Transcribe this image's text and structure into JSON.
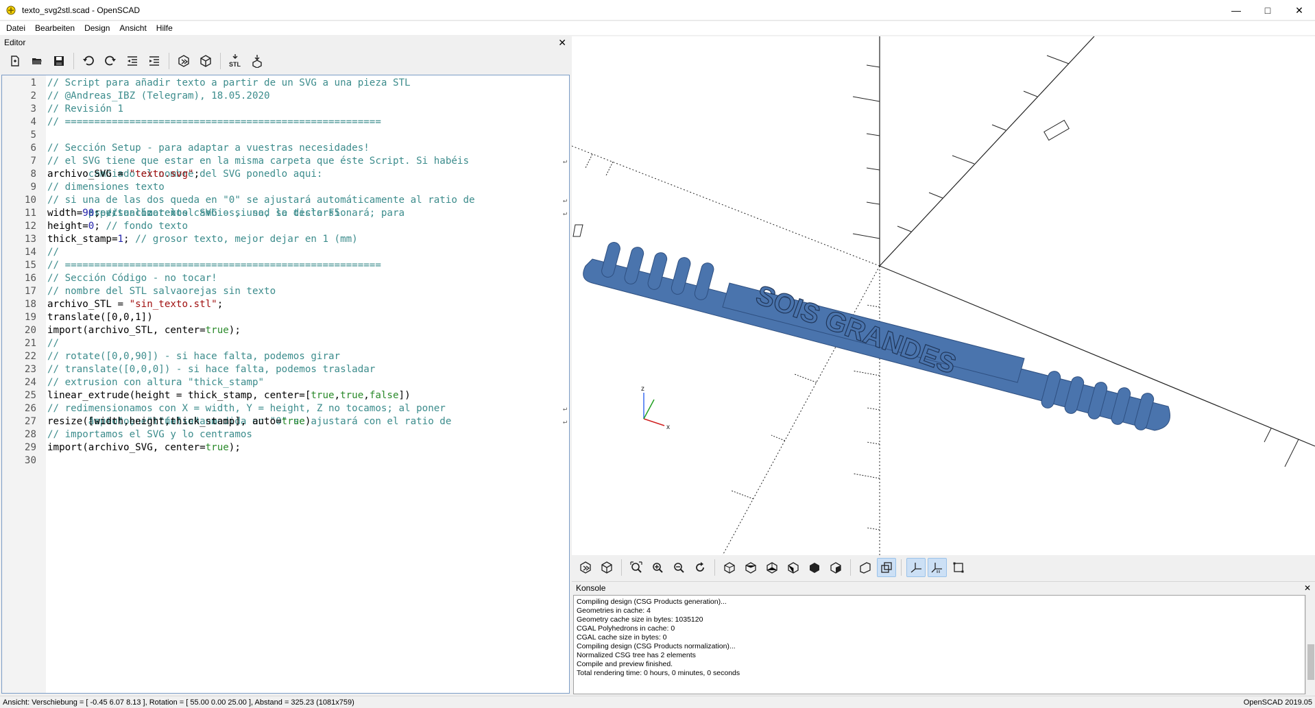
{
  "window": {
    "title": "texto_svg2stl.scad - OpenSCAD",
    "minimize": "—",
    "maximize": "□",
    "close": "✕"
  },
  "menu": [
    "Datei",
    "Bearbeiten",
    "Design",
    "Ansicht",
    "Hilfe"
  ],
  "editor": {
    "title": "Editor",
    "close": "✕",
    "toolbar": [
      "new-file-icon",
      "open-file-icon",
      "save-icon",
      "undo-icon",
      "redo-icon",
      "unindent-icon",
      "indent-icon",
      "preview-icon",
      "render-icon",
      "export-stl-icon",
      "send-to-print-icon"
    ],
    "stl_label": "STL"
  },
  "code": [
    {
      "n": "1",
      "parts": [
        [
          "c",
          "// Script para añadir texto a partir de un SVG a una pieza STL"
        ]
      ]
    },
    {
      "n": "2",
      "parts": [
        [
          "c",
          "// @Andreas_IBZ (Telegram), 18.05.2020"
        ]
      ]
    },
    {
      "n": "3",
      "parts": [
        [
          "c",
          "// Revisión 1"
        ]
      ]
    },
    {
      "n": "4",
      "parts": [
        [
          "c",
          "// ======================================================"
        ]
      ]
    },
    {
      "n": "5",
      "parts": []
    },
    {
      "n": "6",
      "parts": [
        [
          "c",
          "// Sección Setup - para adaptar a vuestras necesidades!"
        ]
      ]
    },
    {
      "n": "7",
      "parts": [
        [
          "c",
          "// el SVG tiene que estar en la misma carpeta que éste Script. Si habéis"
        ]
      ],
      "wrap": true
    },
    {
      "n": "",
      "parts": [
        [
          "c",
          "       cambiado el nombre del SVG ponedlo aqui:"
        ]
      ]
    },
    {
      "n": "8",
      "parts": [
        [
          "p",
          "archivo_SVG = "
        ],
        [
          "s",
          "\"texto.svg\""
        ],
        [
          "p",
          ";"
        ]
      ]
    },
    {
      "n": "9",
      "parts": [
        [
          "c",
          "// dimensiones texto"
        ]
      ]
    },
    {
      "n": "10",
      "parts": [
        [
          "c",
          "// si una de las dos queda en \"0\" se ajustará automáticamente al ratio de"
        ]
      ],
      "wrap": true
    },
    {
      "n": "",
      "parts": [
        [
          "c",
          "       aspecto cómo en el SVG - si no, se distorsionará; para"
        ]
      ],
      "wrap": true
    },
    {
      "n": "",
      "parts": [
        [
          "c",
          "       previsualizar los cambios, usad la tecla F5"
        ]
      ]
    },
    {
      "n": "11",
      "parts": [
        [
          "p",
          "width="
        ],
        [
          "n",
          "90"
        ],
        [
          "p",
          "; "
        ],
        [
          "c",
          "// ancho texto"
        ]
      ]
    },
    {
      "n": "12",
      "parts": [
        [
          "p",
          "height="
        ],
        [
          "n",
          "0"
        ],
        [
          "p",
          "; "
        ],
        [
          "c",
          "// fondo texto"
        ]
      ]
    },
    {
      "n": "13",
      "parts": [
        [
          "p",
          "thick_stamp="
        ],
        [
          "n",
          "1"
        ],
        [
          "p",
          "; "
        ],
        [
          "c",
          "// grosor texto, mejor dejar en 1 (mm)"
        ]
      ]
    },
    {
      "n": "14",
      "parts": [
        [
          "c",
          "//"
        ]
      ]
    },
    {
      "n": "15",
      "parts": [
        [
          "c",
          "// ======================================================"
        ]
      ]
    },
    {
      "n": "16",
      "parts": [
        [
          "c",
          "// Sección Código - no tocar!"
        ]
      ]
    },
    {
      "n": "17",
      "parts": [
        [
          "c",
          "// nombre del STL salvaorejas sin texto"
        ]
      ]
    },
    {
      "n": "18",
      "parts": [
        [
          "p",
          "archivo_STL = "
        ],
        [
          "s",
          "\"sin_texto.stl\""
        ],
        [
          "p",
          ";"
        ]
      ]
    },
    {
      "n": "19",
      "parts": [
        [
          "p",
          "translate([0,0,1])"
        ]
      ]
    },
    {
      "n": "20",
      "parts": [
        [
          "p",
          "import(archivo_STL, center="
        ],
        [
          "b",
          "true"
        ],
        [
          "p",
          ");"
        ]
      ]
    },
    {
      "n": "21",
      "parts": [
        [
          "c",
          "//"
        ]
      ]
    },
    {
      "n": "22",
      "parts": [
        [
          "c",
          "// rotate([0,0,90]) - si hace falta, podemos girar"
        ]
      ]
    },
    {
      "n": "23",
      "parts": [
        [
          "c",
          "// translate([0,0,0]) - si hace falta, podemos trasladar"
        ]
      ]
    },
    {
      "n": "24",
      "parts": [
        [
          "c",
          "// extrusion con altura \"thick_stamp\""
        ]
      ]
    },
    {
      "n": "25",
      "parts": [
        [
          "p",
          "linear_extrude(height = thick_stamp, center=["
        ],
        [
          "b",
          "true"
        ],
        [
          "p",
          ","
        ],
        [
          "b",
          "true"
        ],
        [
          "p",
          ","
        ],
        [
          "b",
          "false"
        ],
        [
          "p",
          "])"
        ]
      ]
    },
    {
      "n": "26",
      "parts": [
        [
          "c",
          "// redimensionamos con X = width, Y = height, Z no tocamos; al poner"
        ]
      ],
      "wrap": true
    },
    {
      "n": "",
      "parts": [
        [
          "c",
          "       \"auto\" en \"true\" una medida en \"0\" se ajustará con el ratio de"
        ]
      ],
      "wrap": true
    },
    {
      "n": "",
      "parts": [
        [
          "c",
          "       aspecto, en \"false\" no"
        ]
      ]
    },
    {
      "n": "27",
      "parts": [
        [
          "p",
          "resize([width,height,thick_stamp], auto="
        ],
        [
          "b",
          "true"
        ],
        [
          "p",
          ")"
        ]
      ]
    },
    {
      "n": "28",
      "parts": [
        [
          "c",
          "// importamos el SVG y lo centramos"
        ]
      ]
    },
    {
      "n": "29",
      "parts": [
        [
          "p",
          "import(archivo_SVG, center="
        ],
        [
          "b",
          "true"
        ],
        [
          "p",
          ");"
        ]
      ]
    },
    {
      "n": "30",
      "parts": []
    }
  ],
  "viewport": {
    "model_text": "SOIS GRANDES",
    "model_color": "#4a74ad",
    "axis_x": "x",
    "axis_z": "z"
  },
  "view_toolbar": [
    "preview-icon",
    "render-icon",
    "view-all-icon",
    "zoom-in-icon",
    "zoom-out-icon",
    "reset-view-icon",
    "view-right-icon",
    "view-top-icon",
    "view-bottom-icon",
    "view-left-icon",
    "view-front-icon",
    "view-back-icon",
    "perspective-icon",
    "orthogonal-icon",
    "show-axes-icon",
    "show-scale-markers-icon",
    "show-edges-icon"
  ],
  "console": {
    "title": "Konsole",
    "close": "✕",
    "lines": [
      "Compiling design (CSG Products generation)...",
      "Geometries in cache: 4",
      "Geometry cache size in bytes: 1035120",
      "CGAL Polyhedrons in cache: 0",
      "CGAL cache size in bytes: 0",
      "Compiling design (CSG Products normalization)...",
      "Normalized CSG tree has 2 elements",
      "Compile and preview finished.",
      "Total rendering time: 0 hours, 0 minutes, 0 seconds"
    ]
  },
  "status": {
    "left": "Ansicht: Verschiebung = [ -0.45 6.07 8.13 ], Rotation = [ 55.00 0.00 25.00 ], Abstand = 325.23 (1081x759)",
    "right": "OpenSCAD 2019.05"
  }
}
